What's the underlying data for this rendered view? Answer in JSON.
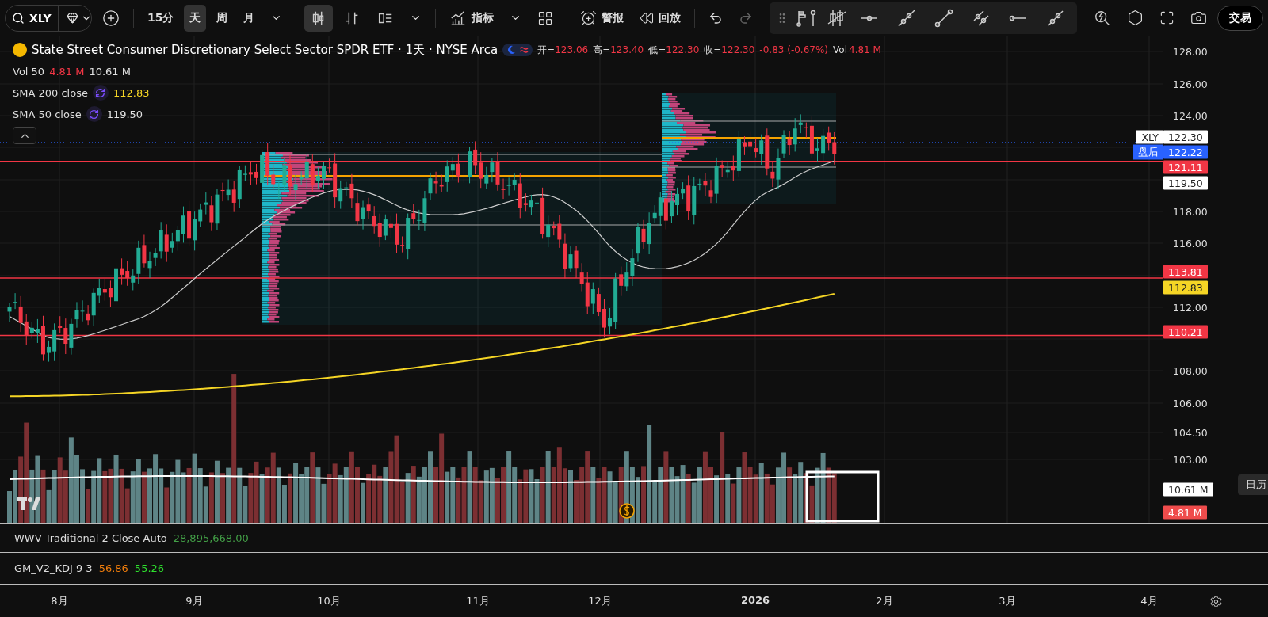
{
  "toolbar": {
    "symbol": "XLY",
    "intervals": [
      {
        "label": "15分",
        "selected": false
      },
      {
        "label": "天",
        "selected": true
      },
      {
        "label": "周",
        "selected": false
      },
      {
        "label": "月",
        "selected": false
      }
    ],
    "chart_types": [
      {
        "kind": "candles",
        "selected": true
      },
      {
        "kind": "bars",
        "selected": false
      },
      {
        "kind": "columns",
        "selected": false
      }
    ],
    "indicators_label": "指标",
    "alerts_label": "警报",
    "replay_label": "回放",
    "trade_label": "交易"
  },
  "legend": {
    "title": "State Street Consumer Discretionary Select Sector SPDR ETF · 1天 · NYSE Arca",
    "ohlc": [
      {
        "label": "开=",
        "value": "123.06"
      },
      {
        "label": "高=",
        "value": "123.40"
      },
      {
        "label": "低=",
        "value": "122.30"
      },
      {
        "label": "收=",
        "value": "122.30"
      }
    ],
    "change": "-0.83 (-0.67%)",
    "volume_label": "Vol",
    "volume_value": "4.81 M",
    "indicators": [
      {
        "name": "Vol 50",
        "kind": "plain",
        "values": [
          {
            "text": "4.81 M",
            "color": "#f23645"
          },
          {
            "text": "10.61 M",
            "color": "#e0e0e0"
          }
        ]
      },
      {
        "name": "SMA 200 close",
        "kind": "sync",
        "values": [
          {
            "text": "112.83",
            "color": "#f5d525"
          }
        ]
      },
      {
        "name": "SMA 50 close",
        "kind": "sync",
        "values": [
          {
            "text": "119.50",
            "color": "#e0e0e0"
          }
        ]
      }
    ]
  },
  "price_axis": {
    "ticks": [
      "128.00",
      "126.00",
      "124.00",
      "118.00",
      "116.00",
      "112.00",
      "108.00",
      "106.00",
      "104.50",
      "103.00"
    ],
    "tags": [
      {
        "kind": "last",
        "label": "XLY",
        "value": "122.30"
      },
      {
        "kind": "after_hours",
        "label": "盘后",
        "value": "122.22"
      },
      {
        "kind": "level",
        "value": "121.11"
      },
      {
        "kind": "sma50",
        "value": "119.50"
      },
      {
        "kind": "level",
        "value": "113.81"
      },
      {
        "kind": "sma200",
        "value": "112.83"
      },
      {
        "kind": "level",
        "value": "110.21"
      },
      {
        "kind": "volume_ma",
        "value": "10.61 M"
      },
      {
        "kind": "volume",
        "value": "4.81 M"
      }
    ],
    "calendar_label": "日历"
  },
  "panes": [
    {
      "name": "WWV Traditional 2 Close Auto",
      "values": [
        {
          "text": "28,895,668.00",
          "color": "#43a047"
        }
      ]
    },
    {
      "name": "GM_V2_KDJ 9 3",
      "values": [
        {
          "text": "56.86",
          "color": "#ef7d0c"
        },
        {
          "text": "55.26",
          "color": "#2ee02e"
        }
      ]
    }
  ],
  "time_axis": [
    {
      "label": "8月",
      "bold": false
    },
    {
      "label": "9月",
      "bold": false
    },
    {
      "label": "10月",
      "bold": false
    },
    {
      "label": "11月",
      "bold": false
    },
    {
      "label": "12月",
      "bold": false
    },
    {
      "label": "2026",
      "bold": true
    },
    {
      "label": "2月",
      "bold": false
    },
    {
      "label": "3月",
      "bold": false
    },
    {
      "label": "4月",
      "bold": false
    }
  ]
}
